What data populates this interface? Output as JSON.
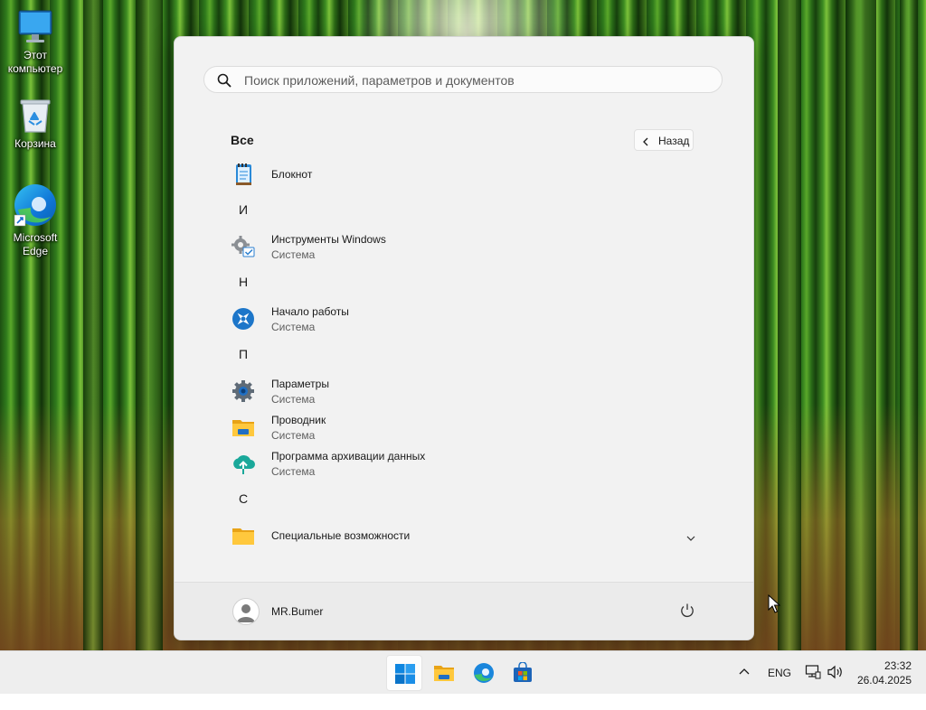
{
  "desktop": {
    "icons": [
      {
        "label": "Этот компьютер",
        "icon": "monitor-icon"
      },
      {
        "label": "Корзина",
        "icon": "recycle-bin-icon"
      },
      {
        "label": "Microsoft Edge",
        "icon": "edge-icon"
      }
    ]
  },
  "start_menu": {
    "search": {
      "placeholder": "Поиск приложений, параметров и документов",
      "value": ""
    },
    "section_title": "Все",
    "back_label": "Назад",
    "groups": [
      {
        "letter": "",
        "apps": [
          {
            "name": "Блокнот",
            "subtitle": "",
            "icon": "notepad-icon"
          }
        ]
      },
      {
        "letter": "И",
        "apps": [
          {
            "name": "Инструменты Windows",
            "subtitle": "Система",
            "icon": "windows-tools-icon"
          }
        ]
      },
      {
        "letter": "Н",
        "apps": [
          {
            "name": "Начало работы",
            "subtitle": "Система",
            "icon": "get-started-icon"
          }
        ]
      },
      {
        "letter": "П",
        "apps": [
          {
            "name": "Параметры",
            "subtitle": "Система",
            "icon": "settings-gear-icon"
          },
          {
            "name": "Проводник",
            "subtitle": "Система",
            "icon": "file-explorer-icon"
          },
          {
            "name": "Программа архивации данных",
            "subtitle": "Система",
            "icon": "backup-icon"
          }
        ]
      },
      {
        "letter": "С",
        "apps": [
          {
            "name": "Специальные возможности",
            "subtitle": "",
            "icon": "folder-icon",
            "expandable": true
          }
        ]
      }
    ],
    "user": {
      "name": "MR.Bumer"
    },
    "power_icon": "power-icon"
  },
  "taskbar": {
    "apps": [
      {
        "name": "start",
        "icon": "windows-start-icon",
        "active": true
      },
      {
        "name": "explorer",
        "icon": "file-explorer-icon",
        "active": false
      },
      {
        "name": "edge",
        "icon": "edge-icon",
        "active": false
      },
      {
        "name": "store",
        "icon": "store-icon",
        "active": false
      }
    ],
    "tray": {
      "overflow_icon": "chevron-up-icon",
      "language": "ENG",
      "network_icon": "network-icon",
      "volume_icon": "volume-icon"
    },
    "clock": {
      "time": "23:32",
      "date": "26.04.2025"
    }
  },
  "colors": {
    "accent": "#0067c0",
    "menu_background": "#f2f2f2",
    "taskbar_background": "#eeeeee"
  }
}
